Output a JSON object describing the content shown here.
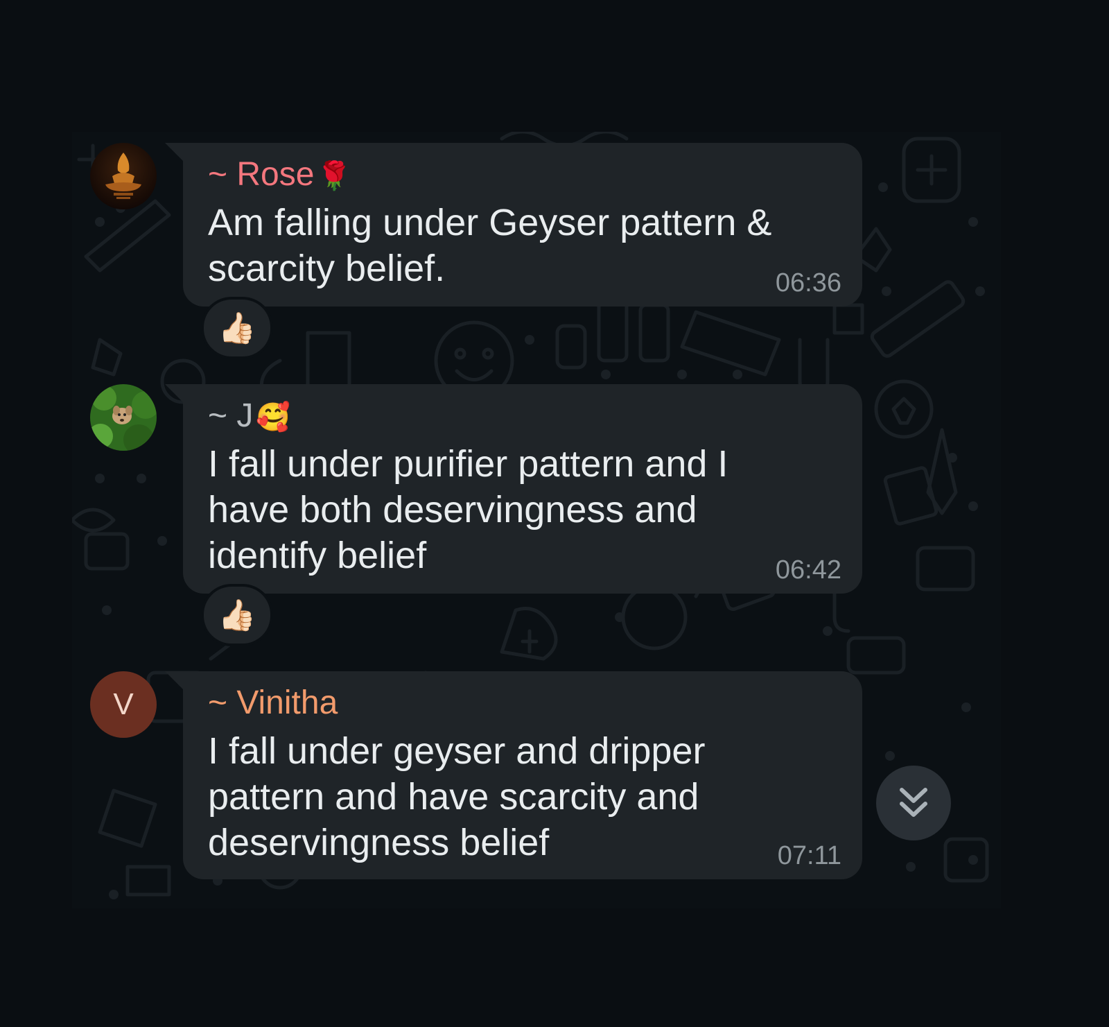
{
  "messages": [
    {
      "sender": "~ Rose",
      "sender_emoji": "🌹",
      "sender_color": "#f4777e",
      "text": "Am falling under Geyser pattern & scarcity belief.",
      "time": "06:36",
      "reaction": "👍🏻",
      "avatar": "temple-logo-icon"
    },
    {
      "sender": "~ J",
      "sender_emoji": "🥰",
      "sender_color": "#b8bdc1",
      "text": "I fall under purifier pattern and I have both deservingness and identify belief",
      "time": "06:42",
      "reaction": "👍🏻",
      "avatar": "dog-photo"
    },
    {
      "sender": "~ Vinitha",
      "sender_emoji": "",
      "sender_color": "#f29b6c",
      "text": "I fall under geyser and dripper pattern  and have scarcity and deservingness belief",
      "time": "07:11",
      "reaction": "",
      "avatar_letter": "V",
      "avatar_color": "#6b2f21"
    }
  ],
  "scroll_button": {
    "icon": "double-chevron-down-icon"
  },
  "colors": {
    "background": "#0a0e12",
    "bubble": "#1f2428",
    "text": "#e9edef",
    "timestamp": "#8f979c"
  }
}
